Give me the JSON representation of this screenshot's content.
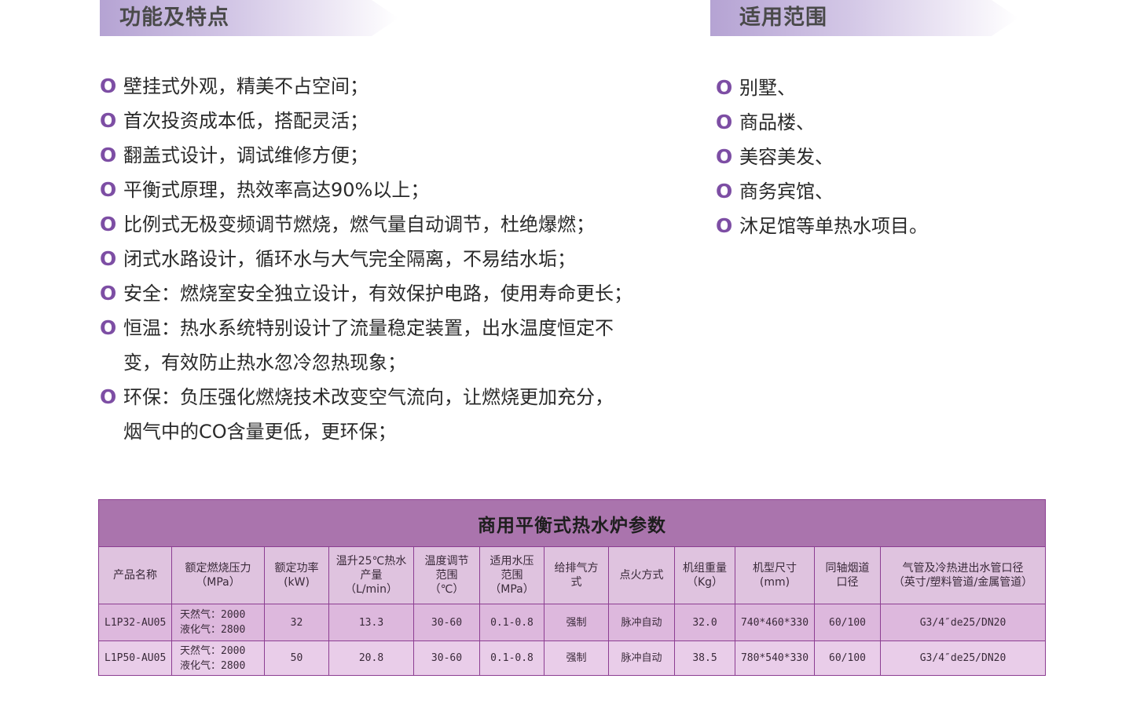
{
  "features_section": {
    "heading": "功能及特点",
    "bullet_glyph": "O",
    "items": [
      [
        "壁挂式外观，精美不占空间；"
      ],
      [
        "首次投资成本低，搭配灵活；"
      ],
      [
        "翻盖式设计，调试维修方便；"
      ],
      [
        "平衡式原理，热效率高达90%以上；"
      ],
      [
        "比例式无极变频调节燃烧，燃气量自动调节，杜绝爆燃；"
      ],
      [
        "闭式水路设计，循环水与大气完全隔离，不易结水垢；"
      ],
      [
        "安全：燃烧室安全独立设计，有效保护电路，使用寿命更长；"
      ],
      [
        "恒温：热水系统特别设计了流量稳定装置，出水温度恒定不",
        "变，有效防止热水忽冷忽热现象；"
      ],
      [
        "环保：负压强化燃烧技术改变空气流向，让燃烧更加充分，",
        "烟气中的CO含量更低，更环保；"
      ]
    ]
  },
  "scope_section": {
    "heading": "适用范围",
    "items": [
      "别墅、",
      "商品楼、",
      "美容美发、",
      "商务宾馆、",
      "沐足馆等单热水项目。"
    ]
  },
  "spec_table": {
    "title": "商用平衡式热水炉参数",
    "headers": [
      [
        "产品名称"
      ],
      [
        "额定燃烧压力",
        "（MPa）"
      ],
      [
        "额定功率",
        "(kW)"
      ],
      [
        "温升25℃热水",
        "产量",
        "（L/min）"
      ],
      [
        "温度调节",
        "范围",
        "（℃）"
      ],
      [
        "适用水压",
        "范围",
        "（MPa）"
      ],
      [
        "给排气方",
        "式"
      ],
      [
        "点火方式"
      ],
      [
        "机组重量",
        "（Kg）"
      ],
      [
        "机型尺寸",
        "(mm)"
      ],
      [
        "同轴烟道",
        "口径"
      ],
      [
        "气管及冷热进出水管口径",
        "（英寸/塑料管道/金属管道）"
      ]
    ],
    "rows": [
      [
        "L1P32-AU05",
        [
          "天然气：2000",
          "液化气：2800"
        ],
        "32",
        "13.3",
        "30-60",
        "0.1-0.8",
        "强制",
        "脉冲自动",
        "32.0",
        "740*460*330",
        "60/100",
        "G3/4″de25/DN20"
      ],
      [
        "L1P50-AU05",
        [
          "天然气：2000",
          "液化气：2800"
        ],
        "50",
        "20.8",
        "30-60",
        "0.1-0.8",
        "强制",
        "脉冲自动",
        "38.5",
        "780*540*330",
        "60/100",
        "G3/4″de25/DN20"
      ]
    ]
  },
  "colors": {
    "bullet": "#7d4ea4",
    "table_caption_bg": "#aa74ad",
    "table_border": "#8c3e92",
    "heading_gradient_start": "#b5a3d3"
  }
}
